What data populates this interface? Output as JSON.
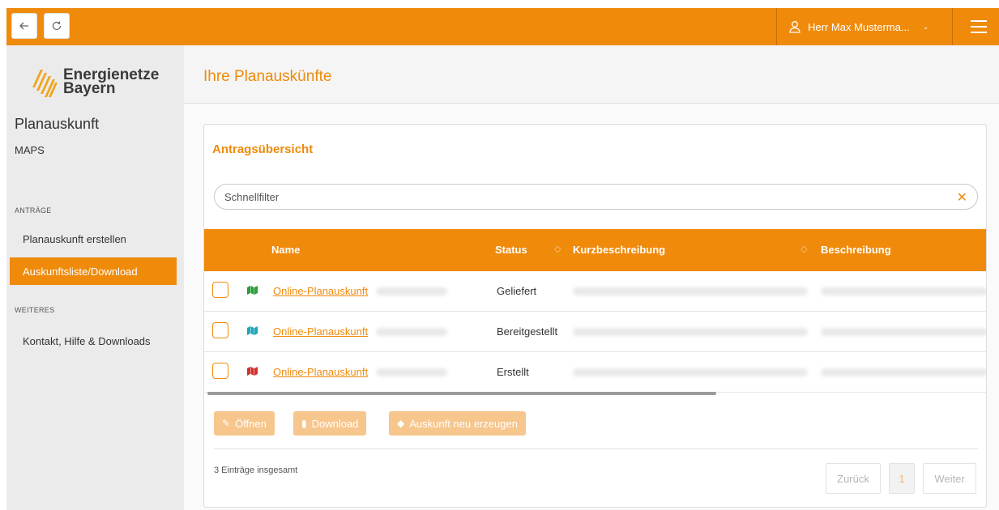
{
  "topbar": {
    "user_name": "Herr Max Musterma...",
    "icons": {
      "back": "arrow-left-icon",
      "reload": "reload-icon",
      "user": "user-icon",
      "menu": "hamburger-menu-icon"
    },
    "accent_color": "#ef8a0b"
  },
  "sidebar": {
    "logo_line1": "Energienetze",
    "logo_line2": "Bayern",
    "app_title": "Planauskunft",
    "maps_label": "MAPS",
    "section_antraege": "ANTRÄGE",
    "item_create": "Planauskunft erstellen",
    "item_list": "Auskunftsliste/Download",
    "section_weiteres": "WEITERES",
    "item_contact": "Kontakt, Hilfe & Downloads"
  },
  "main": {
    "page_title": "Ihre Planauskünfte",
    "panel_title": "Antragsübersicht",
    "filter_placeholder": "Schnellfilter",
    "columns": {
      "name": "Name",
      "status": "Status",
      "short_desc": "Kurzbeschreibung",
      "desc": "Beschreibung"
    },
    "rows": [
      {
        "name": "Online-Planauskunft",
        "status": "Geliefert",
        "icon_color": "#2a9d3a"
      },
      {
        "name": "Online-Planauskunft",
        "status": "Bereitgestellt",
        "icon_color": "#1fa6b8"
      },
      {
        "name": "Online-Planauskunft",
        "status": "Erstellt",
        "icon_color": "#d0312d"
      }
    ],
    "buttons": {
      "open": "Öffnen",
      "download": "Download",
      "regenerate": "Auskunft neu erzeugen"
    },
    "total_text": "3 Einträge insgesamt",
    "pager": {
      "prev": "Zurück",
      "current": "1",
      "next": "Weiter"
    }
  }
}
